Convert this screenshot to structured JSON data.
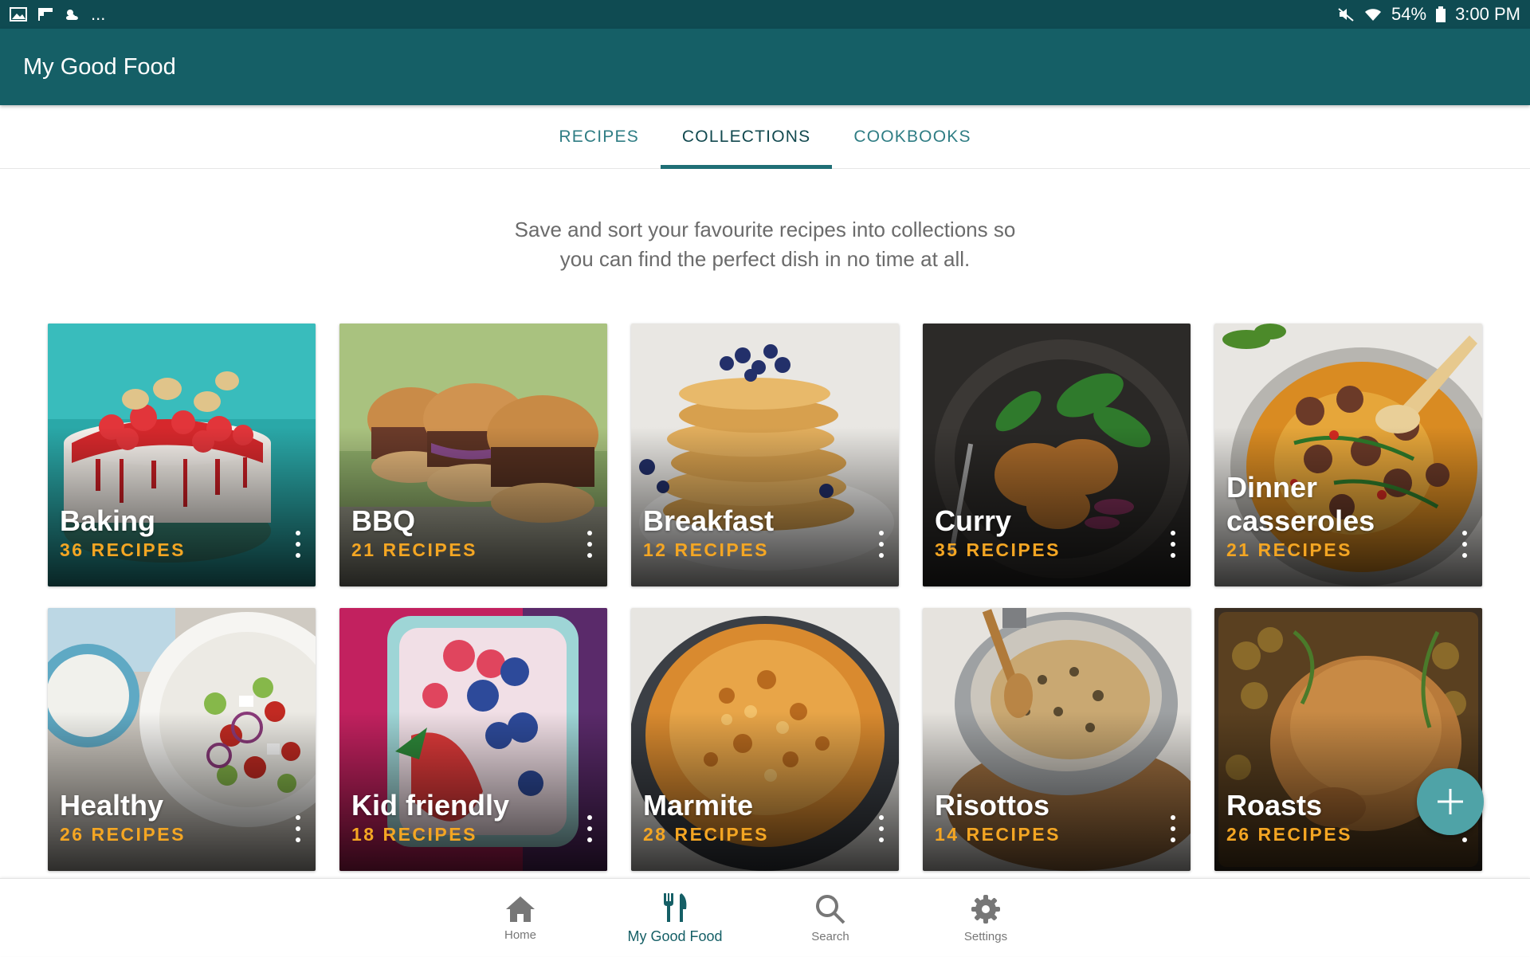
{
  "status_bar": {
    "left_more": "...",
    "battery": "54%",
    "time": "3:00 PM"
  },
  "app": {
    "title": "My Good Food"
  },
  "tabs": [
    {
      "label": "RECIPES",
      "active": false
    },
    {
      "label": "COLLECTIONS",
      "active": true
    },
    {
      "label": "COOKBOOKS",
      "active": false
    }
  ],
  "intro": {
    "line1": "Save and sort your favourite recipes into collections so",
    "line2": "you can find the perfect dish in no time at all."
  },
  "collections": [
    {
      "title": "Baking",
      "count": "36 RECIPES",
      "image": "strawberry-cake"
    },
    {
      "title": "BBQ",
      "count": "21 RECIPES",
      "image": "pulled-pork-burgers"
    },
    {
      "title": "Breakfast",
      "count": "12 RECIPES",
      "image": "blueberry-pancakes"
    },
    {
      "title": "Curry",
      "count": "35 RECIPES",
      "image": "curry-with-greens"
    },
    {
      "title": "Dinner casseroles",
      "count": "21 RECIPES",
      "image": "meatball-casserole"
    },
    {
      "title": "Healthy",
      "count": "26 RECIPES",
      "image": "greek-salad"
    },
    {
      "title": "Kid friendly",
      "count": "18 RECIPES",
      "image": "berry-frozen-yogurt"
    },
    {
      "title": "Marmite",
      "count": "28 RECIPES",
      "image": "mac-and-cheese"
    },
    {
      "title": "Risottos",
      "count": "14 RECIPES",
      "image": "risotto-pan"
    },
    {
      "title": "Roasts",
      "count": "26 RECIPES",
      "image": "roast-chicken"
    }
  ],
  "bottom_nav": [
    {
      "label": "Home",
      "icon": "home-icon",
      "active": false
    },
    {
      "label": "My Good Food",
      "icon": "fork-knife-icon",
      "active": true
    },
    {
      "label": "Search",
      "icon": "search-icon",
      "active": false
    },
    {
      "label": "Settings",
      "icon": "gear-icon",
      "active": false
    }
  ],
  "colors": {
    "status_bar": "#0f4b52",
    "app_bar": "#155f66",
    "accent": "#1f6f76",
    "count_text": "#f4a623",
    "fab": "#4fa3a7"
  }
}
